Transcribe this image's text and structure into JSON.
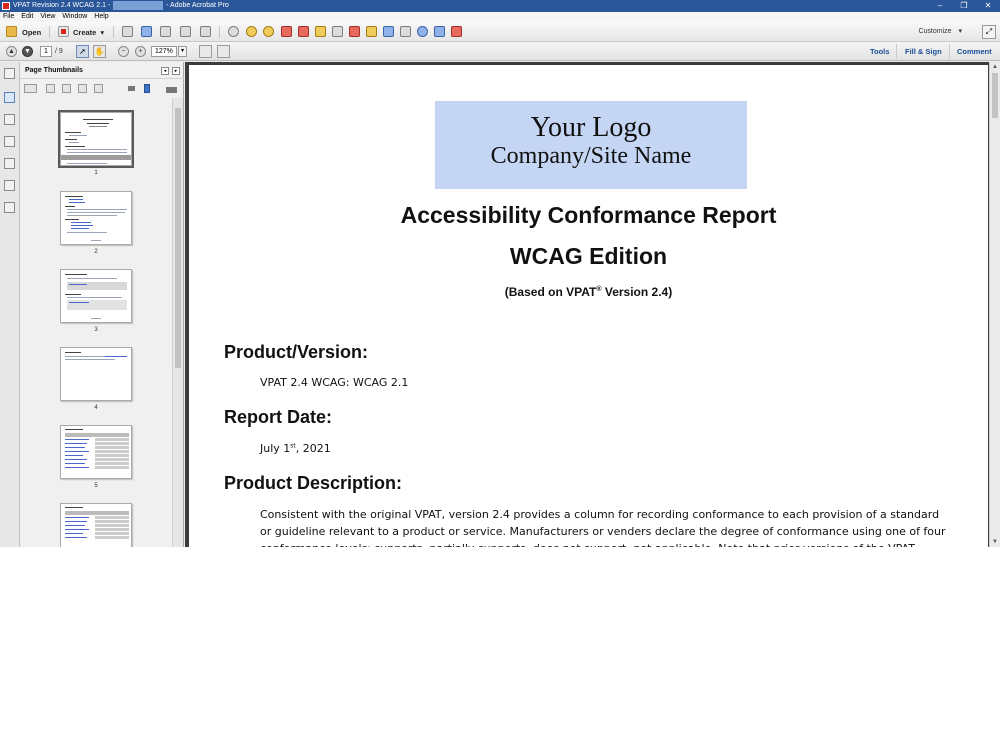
{
  "window": {
    "title_prefix": "VPAT Revision 2.4 WCAG 2.1 -",
    "title_suffix": "- Adobe Acrobat Pro",
    "min": "–",
    "max": "❐",
    "close": "✕"
  },
  "menu": [
    "File",
    "Edit",
    "View",
    "Window",
    "Help"
  ],
  "toolbar": {
    "open_label": "Open",
    "create_label": "Create",
    "create_arrow": "▾",
    "customize_label": "Customize",
    "customize_arrow": "▾",
    "expand_glyph": "⤢"
  },
  "nav": {
    "page_current": "1",
    "page_total": "/ 9",
    "zoom": "127%",
    "zoom_arrow": "▾",
    "tools_label": "Tools",
    "fill_sign_label": "Fill & Sign",
    "comment_label": "Comment",
    "prev_glyph": "▲",
    "next_glyph": "▼",
    "zoom_out_glyph": "−",
    "zoom_in_glyph": "+"
  },
  "panel": {
    "title": "Page Thumbnails",
    "collapse_glyph": "◂",
    "expand_glyph": "▸",
    "thumbnails": [
      {
        "number": "1"
      },
      {
        "number": "2"
      },
      {
        "number": "3"
      },
      {
        "number": "4"
      },
      {
        "number": "5"
      },
      {
        "number": ""
      }
    ]
  },
  "document": {
    "logo_line1": "Your Logo",
    "logo_line2": "Company/Site Name",
    "title": "Accessibility Conformance Report",
    "edition": "WCAG Edition",
    "based_on_prefix": "(Based on VPAT",
    "based_on_sup": "®",
    "based_on_suffix": " Version 2.4)",
    "product_heading": "Product/Version:",
    "product_value": "VPAT 2.4 WCAG: WCAG 2.1",
    "date_heading": "Report Date:",
    "date_prefix": "July 1",
    "date_sup": "st",
    "date_suffix": ", 2021",
    "description_heading": "Product Description:",
    "description": "Consistent with the original VPAT, version 2.4 provides a column for recording conformance to each provision of a standard or guideline relevant to a product or service. Manufacturers or venders declare the degree of conformance using one of four conformance levels: supports, partially supports, does not support, not applicable. Note that prior versions of the VPAT, “partially supports” and",
    "scroll_up": "▲",
    "scroll_down": "▼"
  }
}
